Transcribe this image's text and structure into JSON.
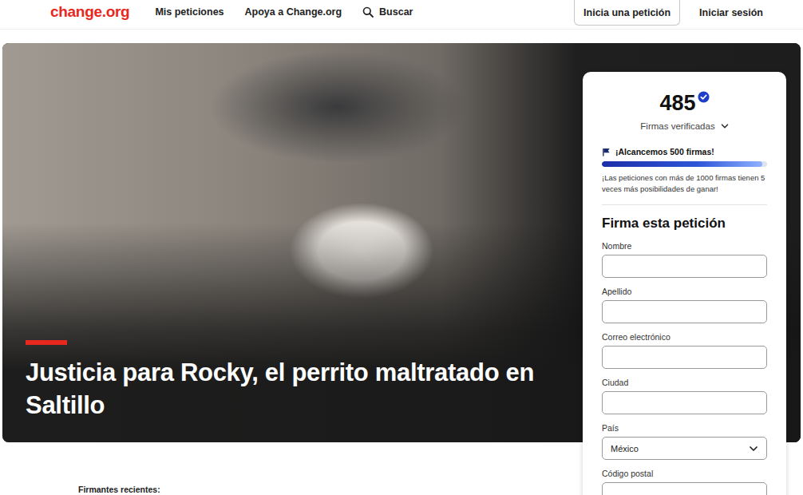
{
  "header": {
    "logo": "change.org",
    "nav": [
      {
        "label": "Mis peticiones"
      },
      {
        "label": "Apoya a Change.org"
      }
    ],
    "search": {
      "label": "Buscar"
    },
    "actions": [
      {
        "label": "Inicia una petición",
        "kind": "outlined"
      },
      {
        "label": "Iniciar sesión",
        "kind": "text"
      }
    ]
  },
  "hero": {
    "title": "Justicia para Rocky, el perrito maltratado en Saltillo"
  },
  "signatures": {
    "count": "485",
    "label": "Firmas verificadas",
    "goal": "¡Alcancemos 500 firmas!",
    "level": 0.97,
    "hint": "¡Las peticiones con más de 1000 firmas tienen 5 veces más posibilidades de ganar!"
  },
  "form": {
    "title": "Firma esta petición",
    "fields": [
      {
        "label": "Nombre",
        "kind": "input",
        "value": ""
      },
      {
        "label": "Apellido",
        "kind": "input",
        "value": ""
      },
      {
        "label": "Correo electrónico",
        "kind": "input",
        "value": ""
      },
      {
        "label": "Ciudad",
        "kind": "input",
        "value": ""
      },
      {
        "label": "País",
        "kind": "select",
        "value": "México"
      },
      {
        "label": "Código postal",
        "kind": "input",
        "value": ""
      }
    ]
  },
  "recent": {
    "title": "Firmantes recientes:"
  }
}
